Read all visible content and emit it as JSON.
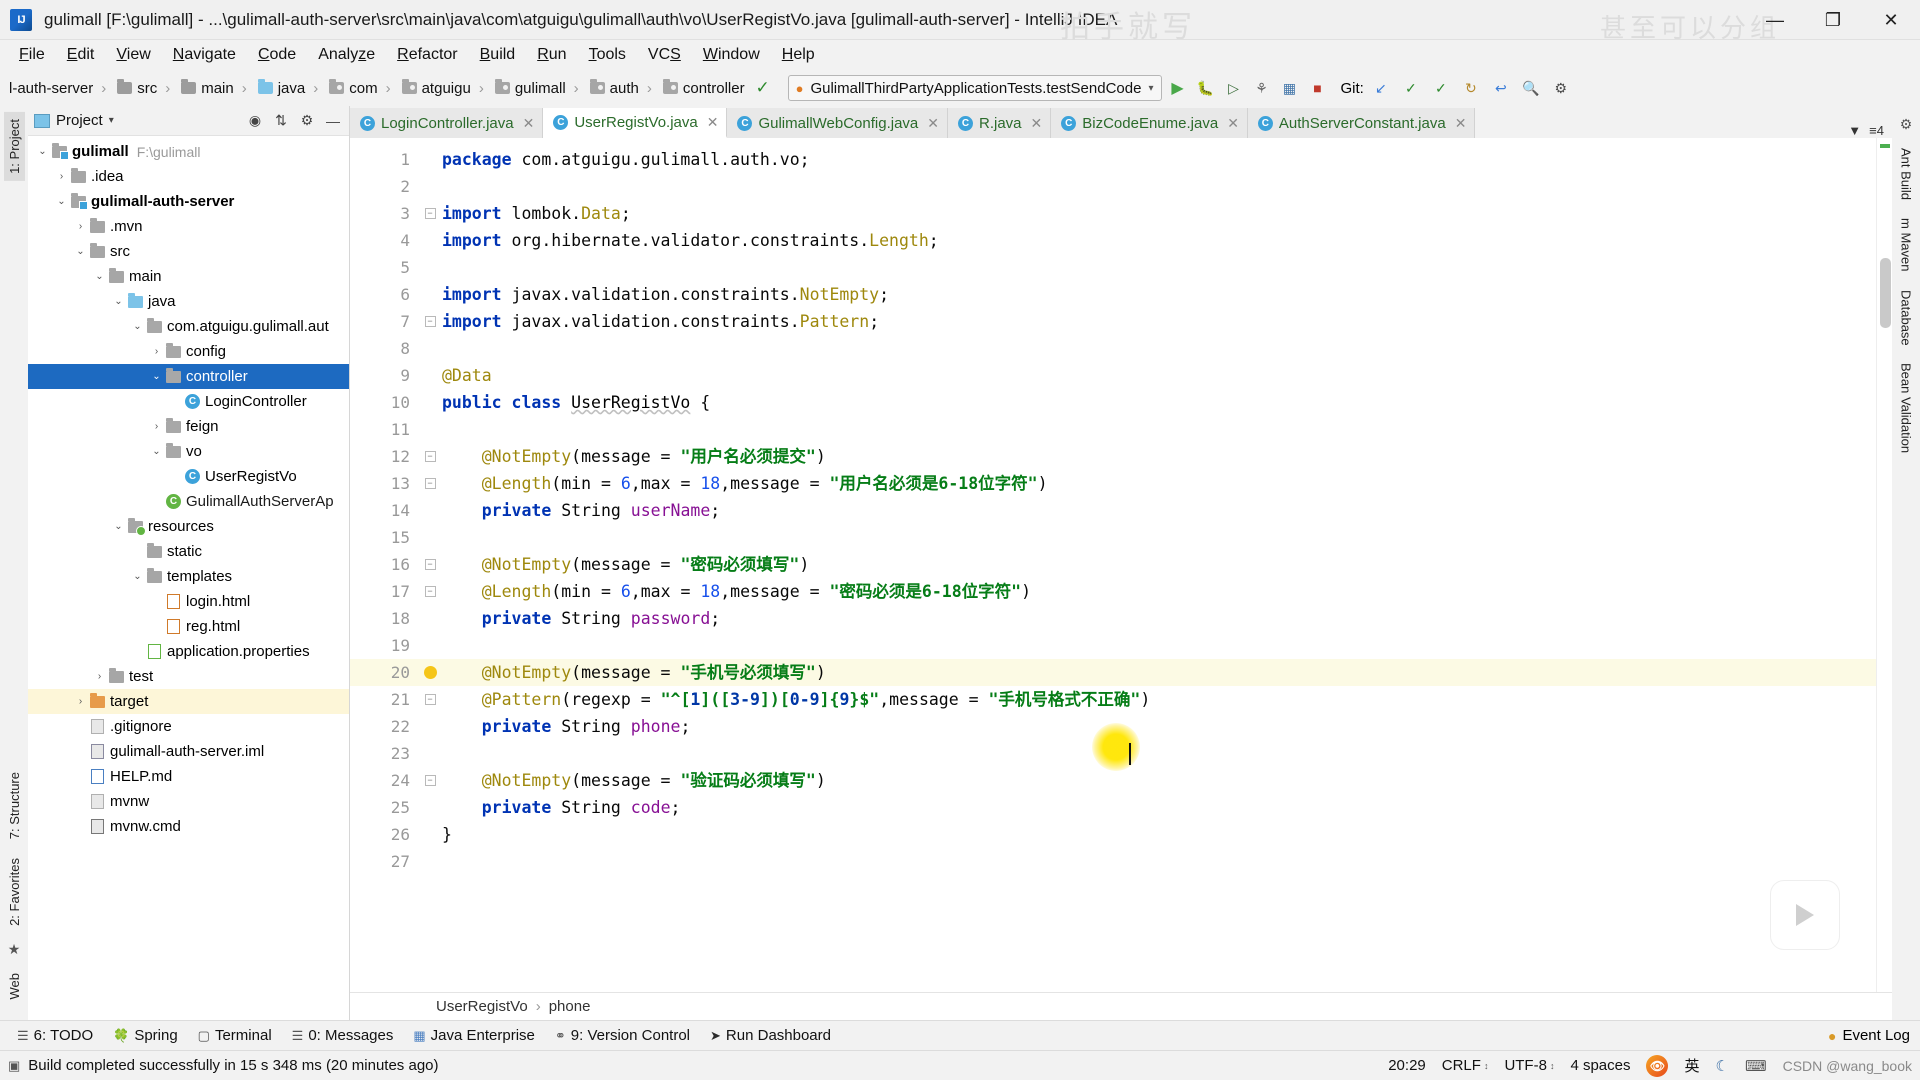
{
  "window": {
    "title": "gulimall [F:\\gulimall] - ...\\gulimall-auth-server\\src\\main\\java\\com\\atguigu\\gulimall\\auth\\vo\\UserRegistVo.java [gulimall-auth-server] - IntelliJ IDEA",
    "logo": "IJ",
    "minimize": "—",
    "maximize": "❐",
    "close": "✕",
    "watermark_center": "拍手就写",
    "watermark_right": "甚至可以分组"
  },
  "menubar": [
    "File",
    "Edit",
    "View",
    "Navigate",
    "Code",
    "Analyze",
    "Refactor",
    "Build",
    "Run",
    "Tools",
    "VCS",
    "Window",
    "Help"
  ],
  "navbar": {
    "crumbs": [
      {
        "label": "l-auth-server",
        "icon": "none"
      },
      {
        "label": "src",
        "icon": "folder-grey"
      },
      {
        "label": "main",
        "icon": "folder-grey"
      },
      {
        "label": "java",
        "icon": "folder-blue"
      },
      {
        "label": "com",
        "icon": "folder-package"
      },
      {
        "label": "atguigu",
        "icon": "folder-package"
      },
      {
        "label": "gulimall",
        "icon": "folder-package"
      },
      {
        "label": "auth",
        "icon": "folder-package"
      },
      {
        "label": "controller",
        "icon": "folder-package"
      }
    ],
    "run_config": "GulimallThirdPartyApplicationTests.testSendCode",
    "run_dropdown": "▾",
    "git_label": "Git:",
    "toolbar_icons": [
      "run-icon",
      "debug-icon",
      "run-with-coverage-icon",
      "profiler-icon",
      "build-icon",
      "stop-icon"
    ],
    "git_icons": [
      "update-project-icon",
      "commit-icon",
      "push-icon",
      "history-icon",
      "revert-icon"
    ],
    "right_icons": [
      "search-everywhere-icon",
      "settings-icon"
    ]
  },
  "left_tool_tabs": [
    {
      "label": "1: Project",
      "selected": true
    },
    {
      "label": "7: Structure",
      "selected": false
    },
    {
      "label": "2: Favorites",
      "selected": false
    },
    {
      "label": "Web",
      "selected": false
    }
  ],
  "right_tool_tabs": [
    {
      "label": "Ant Build"
    },
    {
      "label": "m Maven"
    },
    {
      "label": "Database"
    },
    {
      "label": "Bean Validation"
    }
  ],
  "project_panel": {
    "title": "Project",
    "title_caret": "▾",
    "header_icons": [
      "locate-icon",
      "collapse-all-icon",
      "settings-icon",
      "hide-icon"
    ],
    "tree": [
      {
        "depth": 0,
        "arrow": "down",
        "icon": "module-folder",
        "label": "gulimall",
        "bold": true,
        "path": "F:\\gulimall",
        "selected": false
      },
      {
        "depth": 1,
        "arrow": "right",
        "icon": "folder-grey",
        "label": ".idea",
        "bold": false,
        "selected": false
      },
      {
        "depth": 1,
        "arrow": "down",
        "icon": "module-folder",
        "label": "gulimall-auth-server",
        "bold": true,
        "selected": false
      },
      {
        "depth": 2,
        "arrow": "right",
        "icon": "folder-grey",
        "label": ".mvn",
        "bold": false,
        "selected": false
      },
      {
        "depth": 2,
        "arrow": "down",
        "icon": "folder-grey",
        "label": "src",
        "bold": false,
        "selected": false
      },
      {
        "depth": 3,
        "arrow": "down",
        "icon": "folder-grey",
        "label": "main",
        "bold": false,
        "selected": false
      },
      {
        "depth": 4,
        "arrow": "down",
        "icon": "folder-blue",
        "label": "java",
        "bold": false,
        "selected": false
      },
      {
        "depth": 5,
        "arrow": "down",
        "icon": "folder-package",
        "label": "com.atguigu.gulimall.aut",
        "bold": false,
        "selected": false
      },
      {
        "depth": 6,
        "arrow": "right",
        "icon": "folder-package",
        "label": "config",
        "bold": false,
        "selected": false
      },
      {
        "depth": 6,
        "arrow": "down",
        "icon": "folder-package",
        "label": "controller",
        "bold": false,
        "selected": true
      },
      {
        "depth": 7,
        "arrow": "none",
        "icon": "class-blue",
        "label": "LoginController",
        "bold": false,
        "selected": false
      },
      {
        "depth": 6,
        "arrow": "right",
        "icon": "folder-package",
        "label": "feign",
        "bold": false,
        "selected": false
      },
      {
        "depth": 6,
        "arrow": "down",
        "icon": "folder-package",
        "label": "vo",
        "bold": false,
        "selected": false
      },
      {
        "depth": 7,
        "arrow": "none",
        "icon": "class-blue",
        "label": "UserRegistVo",
        "bold": false,
        "selected": false
      },
      {
        "depth": 6,
        "arrow": "none",
        "icon": "class-green",
        "label": "GulimallAuthServerAp",
        "bold": false,
        "selected": false,
        "green": true
      },
      {
        "depth": 4,
        "arrow": "down",
        "icon": "folder-resource",
        "label": "resources",
        "bold": false,
        "selected": false
      },
      {
        "depth": 5,
        "arrow": "none",
        "icon": "folder-grey",
        "label": "static",
        "bold": false,
        "selected": false
      },
      {
        "depth": 5,
        "arrow": "down",
        "icon": "folder-grey",
        "label": "templates",
        "bold": false,
        "selected": false
      },
      {
        "depth": 6,
        "arrow": "none",
        "icon": "html-file",
        "label": "login.html",
        "bold": false,
        "selected": false
      },
      {
        "depth": 6,
        "arrow": "none",
        "icon": "html-file",
        "label": "reg.html",
        "bold": false,
        "selected": false
      },
      {
        "depth": 5,
        "arrow": "none",
        "icon": "properties-file",
        "label": "application.properties",
        "bold": false,
        "selected": false
      },
      {
        "depth": 3,
        "arrow": "right",
        "icon": "folder-grey",
        "label": "test",
        "bold": false,
        "selected": false
      },
      {
        "depth": 2,
        "arrow": "right",
        "icon": "folder-orange",
        "label": "target",
        "bold": false,
        "selected": false,
        "highlight": true
      },
      {
        "depth": 2,
        "arrow": "none",
        "icon": "text-file",
        "label": ".gitignore",
        "bold": false,
        "selected": false
      },
      {
        "depth": 2,
        "arrow": "none",
        "icon": "iml-file",
        "label": "gulimall-auth-server.iml",
        "bold": false,
        "selected": false
      },
      {
        "depth": 2,
        "arrow": "none",
        "icon": "md-file",
        "label": "HELP.md",
        "bold": false,
        "selected": false
      },
      {
        "depth": 2,
        "arrow": "none",
        "icon": "text-file",
        "label": "mvnw",
        "bold": false,
        "selected": false
      },
      {
        "depth": 2,
        "arrow": "none",
        "icon": "cmd-file",
        "label": "mvnw.cmd",
        "bold": false,
        "selected": false
      }
    ]
  },
  "editor": {
    "tabs": [
      {
        "label": "LoginController.java",
        "active": false,
        "icon": "java-class-icon"
      },
      {
        "label": "UserRegistVo.java",
        "active": true,
        "icon": "java-class-icon"
      },
      {
        "label": "GulimallWebConfig.java",
        "active": false,
        "icon": "java-class-icon"
      },
      {
        "label": "R.java",
        "active": false,
        "icon": "java-class-icon"
      },
      {
        "label": "BizCodeEnume.java",
        "active": false,
        "icon": "java-class-icon"
      },
      {
        "label": "AuthServerConstant.java",
        "active": false,
        "icon": "java-class-icon"
      }
    ],
    "tab_close": "✕",
    "tabs_right_icons": [
      "minimize-icon",
      "list-icon"
    ],
    "line_numbers": [
      1,
      2,
      3,
      4,
      5,
      6,
      7,
      8,
      9,
      10,
      11,
      12,
      13,
      14,
      15,
      16,
      17,
      18,
      19,
      20,
      21,
      22,
      23,
      24,
      25,
      26,
      27
    ],
    "current_line": 20,
    "breadcrumb": [
      "UserRegistVo",
      "phone"
    ],
    "breadcrumb_sep": "›",
    "code_lines": [
      {
        "n": 1,
        "tokens": [
          {
            "t": "package ",
            "c": "kw"
          },
          {
            "t": "com.atguigu.gulimall.auth.vo;",
            "c": "pln"
          }
        ],
        "indent": 0
      },
      {
        "n": 2,
        "tokens": [],
        "indent": 0
      },
      {
        "n": 3,
        "tokens": [
          {
            "t": "import ",
            "c": "kw"
          },
          {
            "t": "lombok.",
            "c": "pln"
          },
          {
            "t": "Data",
            "c": "ann"
          },
          {
            "t": ";",
            "c": "pln"
          }
        ],
        "indent": 0,
        "fold": "minus"
      },
      {
        "n": 4,
        "tokens": [
          {
            "t": "import ",
            "c": "kw"
          },
          {
            "t": "org.hibernate.validator.constraints.",
            "c": "pln"
          },
          {
            "t": "Length",
            "c": "ann"
          },
          {
            "t": ";",
            "c": "pln"
          }
        ],
        "indent": 0
      },
      {
        "n": 5,
        "tokens": [],
        "indent": 0
      },
      {
        "n": 6,
        "tokens": [
          {
            "t": "import ",
            "c": "kw"
          },
          {
            "t": "javax.validation.constraints.",
            "c": "pln"
          },
          {
            "t": "NotEmpty",
            "c": "ann"
          },
          {
            "t": ";",
            "c": "pln"
          }
        ],
        "indent": 0
      },
      {
        "n": 7,
        "tokens": [
          {
            "t": "import ",
            "c": "kw"
          },
          {
            "t": "javax.validation.constraints.",
            "c": "pln"
          },
          {
            "t": "Pattern",
            "c": "ann"
          },
          {
            "t": ";",
            "c": "pln"
          }
        ],
        "indent": 0,
        "fold": "minus"
      },
      {
        "n": 8,
        "tokens": [],
        "indent": 0
      },
      {
        "n": 9,
        "tokens": [
          {
            "t": "@Data",
            "c": "ann"
          }
        ],
        "indent": 0
      },
      {
        "n": 10,
        "tokens": [
          {
            "t": "public class ",
            "c": "kw"
          },
          {
            "t": "UserRegistVo",
            "c": "wavy"
          },
          {
            "t": " {",
            "c": "pln"
          }
        ],
        "indent": 0
      },
      {
        "n": 11,
        "tokens": [],
        "indent": 0
      },
      {
        "n": 12,
        "tokens": [
          {
            "t": "@NotEmpty",
            "c": "ann"
          },
          {
            "t": "(message = ",
            "c": "pln"
          },
          {
            "t": "\"用户名必须提交\"",
            "c": "str"
          },
          {
            "t": ")",
            "c": "pln"
          }
        ],
        "indent": 1,
        "fold": "minus"
      },
      {
        "n": 13,
        "tokens": [
          {
            "t": "@Length",
            "c": "ann"
          },
          {
            "t": "(min = ",
            "c": "pln"
          },
          {
            "t": "6",
            "c": "num"
          },
          {
            "t": ",max = ",
            "c": "pln"
          },
          {
            "t": "18",
            "c": "num"
          },
          {
            "t": ",message = ",
            "c": "pln"
          },
          {
            "t": "\"用户名必须是6-18位字符\"",
            "c": "str"
          },
          {
            "t": ")",
            "c": "pln"
          }
        ],
        "indent": 1,
        "fold": "minus"
      },
      {
        "n": 14,
        "tokens": [
          {
            "t": "private ",
            "c": "kw"
          },
          {
            "t": "String ",
            "c": "pln"
          },
          {
            "t": "userName",
            "c": "fld"
          },
          {
            "t": ";",
            "c": "pln"
          }
        ],
        "indent": 1
      },
      {
        "n": 15,
        "tokens": [],
        "indent": 0
      },
      {
        "n": 16,
        "tokens": [
          {
            "t": "@NotEmpty",
            "c": "ann"
          },
          {
            "t": "(message = ",
            "c": "pln"
          },
          {
            "t": "\"密码必须填写\"",
            "c": "str"
          },
          {
            "t": ")",
            "c": "pln"
          }
        ],
        "indent": 1,
        "fold": "minus"
      },
      {
        "n": 17,
        "tokens": [
          {
            "t": "@Length",
            "c": "ann"
          },
          {
            "t": "(min = ",
            "c": "pln"
          },
          {
            "t": "6",
            "c": "num"
          },
          {
            "t": ",max = ",
            "c": "pln"
          },
          {
            "t": "18",
            "c": "num"
          },
          {
            "t": ",message = ",
            "c": "pln"
          },
          {
            "t": "\"密码必须是6-18位字符\"",
            "c": "str"
          },
          {
            "t": ")",
            "c": "pln"
          }
        ],
        "indent": 1,
        "fold": "minus"
      },
      {
        "n": 18,
        "tokens": [
          {
            "t": "private ",
            "c": "kw"
          },
          {
            "t": "String ",
            "c": "pln"
          },
          {
            "t": "password",
            "c": "fld"
          },
          {
            "t": ";",
            "c": "pln"
          }
        ],
        "indent": 1
      },
      {
        "n": 19,
        "tokens": [],
        "indent": 0
      },
      {
        "n": 20,
        "tokens": [
          {
            "t": "@NotEmpty",
            "c": "ann"
          },
          {
            "t": "(message = ",
            "c": "pln"
          },
          {
            "t": "\"手机号必须填写\"",
            "c": "str"
          },
          {
            "t": ")",
            "c": "pln"
          }
        ],
        "indent": 1,
        "fold": "bulb",
        "current": true
      },
      {
        "n": 21,
        "tokens": [
          {
            "t": "@Pattern",
            "c": "ann"
          },
          {
            "t": "(regexp = ",
            "c": "pln"
          },
          {
            "t": "\"^[",
            "c": "str"
          },
          {
            "t": "1",
            "c": "regex"
          },
          {
            "t": "]([",
            "c": "str"
          },
          {
            "t": "3-9",
            "c": "regex"
          },
          {
            "t": "])[",
            "c": "str"
          },
          {
            "t": "0-9",
            "c": "regex"
          },
          {
            "t": "]{",
            "c": "str"
          },
          {
            "t": "9",
            "c": "regex"
          },
          {
            "t": "}$\"",
            "c": "str"
          },
          {
            "t": ",message = ",
            "c": "pln"
          },
          {
            "t": "\"手机号格式不正确\"",
            "c": "str"
          },
          {
            "t": ")",
            "c": "pln"
          }
        ],
        "indent": 1,
        "fold": "minus"
      },
      {
        "n": 22,
        "tokens": [
          {
            "t": "private ",
            "c": "kw"
          },
          {
            "t": "String ",
            "c": "pln"
          },
          {
            "t": "phone",
            "c": "fld"
          },
          {
            "t": ";",
            "c": "pln"
          }
        ],
        "indent": 1
      },
      {
        "n": 23,
        "tokens": [],
        "indent": 0
      },
      {
        "n": 24,
        "tokens": [
          {
            "t": "@NotEmpty",
            "c": "ann"
          },
          {
            "t": "(message = ",
            "c": "pln"
          },
          {
            "t": "\"验证码必须填写\"",
            "c": "str"
          },
          {
            "t": ")",
            "c": "pln"
          }
        ],
        "indent": 1,
        "fold": "minus"
      },
      {
        "n": 25,
        "tokens": [
          {
            "t": "private ",
            "c": "kw"
          },
          {
            "t": "String ",
            "c": "pln"
          },
          {
            "t": "code",
            "c": "fld"
          },
          {
            "t": ";",
            "c": "pln"
          }
        ],
        "indent": 1
      },
      {
        "n": 26,
        "tokens": [
          {
            "t": "}",
            "c": "pln"
          }
        ],
        "indent": 0
      },
      {
        "n": 27,
        "tokens": [],
        "indent": 0
      }
    ]
  },
  "bottom_tools": [
    {
      "label": "6: TODO",
      "underline": "6",
      "icon": "todo-icon"
    },
    {
      "label": "Spring",
      "icon": "spring-icon"
    },
    {
      "label": "Terminal",
      "icon": "terminal-icon"
    },
    {
      "label": "0: Messages",
      "underline": "0",
      "icon": "messages-icon"
    },
    {
      "label": "Java Enterprise",
      "icon": "java-ee-icon"
    },
    {
      "label": "9: Version Control",
      "underline": "9",
      "icon": "vcs-icon"
    },
    {
      "label": "Run Dashboard",
      "icon": "run-dashboard-icon"
    }
  ],
  "bottom_right": {
    "label": "Event Log",
    "icon": "event-log-icon"
  },
  "statusbar": {
    "message": "Build completed successfully in 15 s 348 ms (20 minutes ago)",
    "caret_position": "20:29",
    "line_separator": "CRLF",
    "encoding": "UTF-8",
    "indent": "4 spaces",
    "chevron": "↕",
    "ime_label": "英",
    "watermark": "CSDN @wang_book"
  }
}
